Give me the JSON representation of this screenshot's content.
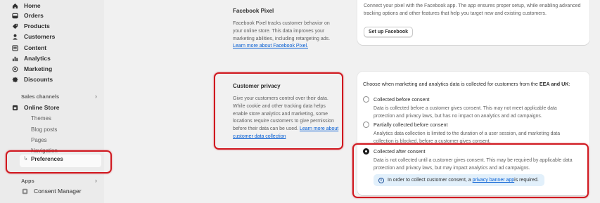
{
  "sidebar": {
    "items": [
      {
        "label": "Home",
        "icon": "home-icon"
      },
      {
        "label": "Orders",
        "icon": "orders-icon"
      },
      {
        "label": "Products",
        "icon": "tag-icon"
      },
      {
        "label": "Customers",
        "icon": "person-icon"
      },
      {
        "label": "Content",
        "icon": "content-icon"
      },
      {
        "label": "Analytics",
        "icon": "bar-chart-icon"
      },
      {
        "label": "Marketing",
        "icon": "target-icon"
      },
      {
        "label": "Discounts",
        "icon": "discount-icon"
      }
    ],
    "sales_channels_label": "Sales channels",
    "online_store": {
      "label": "Online Store",
      "icon": "store-icon"
    },
    "online_store_sub": [
      "Themes",
      "Blog posts",
      "Pages",
      "Navigation"
    ],
    "preferences_label": "Preferences",
    "apps_label": "Apps",
    "consent_manager": {
      "label": "Consent Manager",
      "icon": "app-icon"
    }
  },
  "facebook_pixel": {
    "title": "Facebook Pixel",
    "description": "Facebook Pixel tracks customer behavior on your online store. This data improves your marketing abilities, including retargeting ads.",
    "link": "Learn more about Facebook Pixel.",
    "card_text": "Connect your pixel with the Facebook app. The app ensures proper setup, while enabling advanced tracking options and other features that help you target new and existing customers.",
    "button": "Set up Facebook"
  },
  "customer_privacy": {
    "title": "Customer privacy",
    "description": "Give your customers control over their data. While cookie and other tracking data helps enable store analytics and marketing, some locations require customers to give permission before their data can be used.",
    "link": "Learn more about customer data collection",
    "intro_prefix": "Choose when marketing and analytics data is collected for customers from the ",
    "intro_bold": "EEA and UK",
    "intro_suffix": ":",
    "options": [
      {
        "label": "Collected before consent",
        "desc": "Data is collected before a customer gives consent. This may not meet applicable data protection and privacy laws, but has no impact on analytics and ad campaigns.",
        "checked": false
      },
      {
        "label": "Partially collected before consent",
        "desc": "Analytics data collection is limited to the duration of a user session, and marketing data collection is blocked, before a customer gives consent.",
        "checked": false
      },
      {
        "label": "Collected after consent",
        "desc": "Data is not collected until a customer gives consent. This may be required by applicable data protection and privacy laws, but may impact analytics and ad campaigns.",
        "checked": true
      }
    ],
    "banner_prefix": "In order to collect customer consent, a ",
    "banner_link": "privacy banner app",
    "banner_suffix": " is required."
  },
  "colors": {
    "highlight": "#d0181f",
    "link": "#005bd3",
    "banner_bg": "#e2f0fb"
  }
}
